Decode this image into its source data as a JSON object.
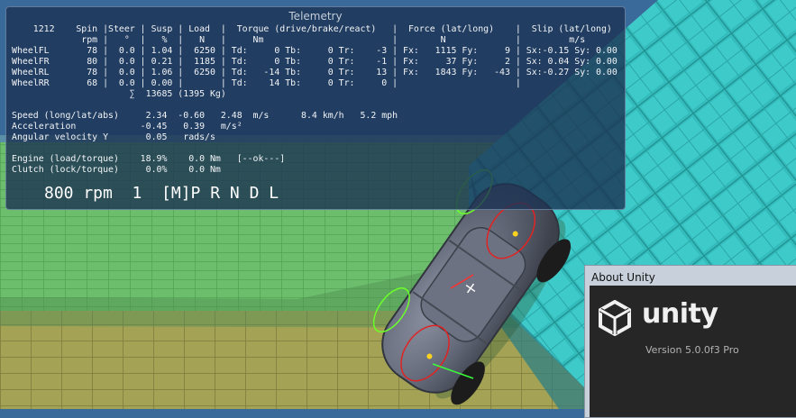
{
  "telemetry": {
    "title": "Telemetry",
    "lines": [
      "    1212    Spin |Steer | Susp | Load  |  Torque (drive/brake/react)   |  Force (lat/long)    |  Slip (lat/long)",
      "             rpm |   °  |   %  |   N   |     Nm                        |        N             |         m/s",
      "WheelFL       78 |  0.0 | 1.04 |  6250 | Td:     0 Tb:     0 Tr:    -3 | Fx:   1115 Fy:     9 | Sx:-0.15 Sy: 0.00",
      "WheelFR       80 |  0.0 | 0.21 |  1185 | Td:     0 Tb:     0 Tr:    -1 | Fx:     37 Fy:     2 | Sx: 0.04 Sy: 0.00",
      "WheelRL       78 |  0.0 | 1.06 |  6250 | Td:   -14 Tb:     0 Tr:    13 | Fx:   1843 Fy:   -43 | Sx:-0.27 Sy: 0.00",
      "WheelRR       68 |  0.0 | 0.00 |       | Td:    14 Tb:     0 Tr:     0 |                      |",
      "                      ∑  13685 (1395 Kg)",
      "",
      "Speed (long/lat/abs)     2.34  -0.60   2.48  m/s      8.4 km/h   5.2 mph",
      "Acceleration            -0.45   0.39   m/s²",
      "Angular velocity Y       0.05   rads/s",
      "",
      "Engine (load/torque)    18.9%    0.0 Nm   [--ok---]",
      "Clutch (lock/torque)     0.0%    0.0 Nm"
    ],
    "gear_line": "800 rpm  1  [M]P R N D L"
  },
  "about": {
    "title": "About Unity",
    "wordmark": "unity",
    "version": "Version 5.0.0f3 Pro"
  },
  "colors": {
    "sky": "#3a6a9a",
    "ground_green": "#66b566",
    "ground_yellow": "#9c9a4e",
    "wall_cyan": "#33b9b9",
    "car_body": "#5f6574"
  }
}
